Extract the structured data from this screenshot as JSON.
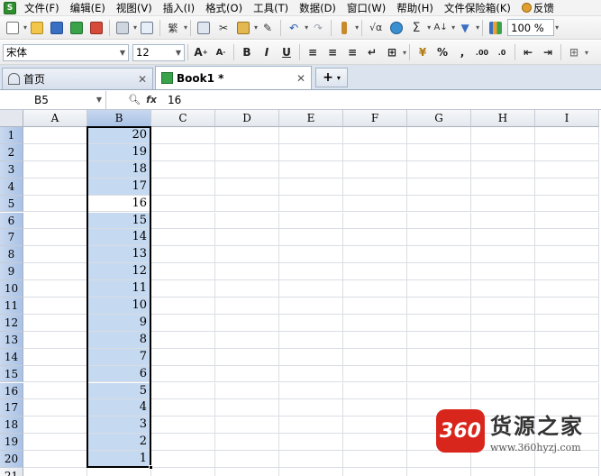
{
  "menu": {
    "items": [
      "文件(F)",
      "编辑(E)",
      "视图(V)",
      "插入(I)",
      "格式(O)",
      "工具(T)",
      "数据(D)",
      "窗口(W)",
      "帮助(H)",
      "文件保险箱(K)",
      "反馈"
    ]
  },
  "toolbar": {
    "zoom": "100 %",
    "font_name": "宋体",
    "font_size": "12",
    "bold": "B",
    "italic": "I",
    "underline": "U",
    "sum": "Σ",
    "percent": "%",
    "comma": ",",
    "sqrt": "√α"
  },
  "tabs": {
    "home": {
      "label": "首页",
      "close": "✕"
    },
    "book": {
      "label": "Book1 *",
      "close": "✕"
    },
    "new": "+"
  },
  "formula_bar": {
    "cell_ref": "B5",
    "value": "16",
    "fx": "fx"
  },
  "sheet": {
    "columns": [
      "A",
      "B",
      "C",
      "D",
      "E",
      "F",
      "G",
      "H",
      "I"
    ],
    "rows": [
      "1",
      "2",
      "3",
      "4",
      "5",
      "6",
      "7",
      "8",
      "9",
      "10",
      "11",
      "12",
      "13",
      "14",
      "15",
      "16",
      "17",
      "18",
      "19",
      "20",
      "21"
    ],
    "column_b_values": [
      "20",
      "19",
      "18",
      "17",
      "16",
      "15",
      "14",
      "13",
      "12",
      "11",
      "10",
      "9",
      "8",
      "7",
      "6",
      "5",
      "4",
      "3",
      "2",
      "1"
    ],
    "selected_column": "B",
    "active_row": "5",
    "colors": {
      "selection": "#c5d9f1",
      "header_selected": "#a9c2e6"
    }
  },
  "watermark": {
    "badge": "360",
    "title": "货源之家",
    "url": "www.360hyzj.com"
  }
}
